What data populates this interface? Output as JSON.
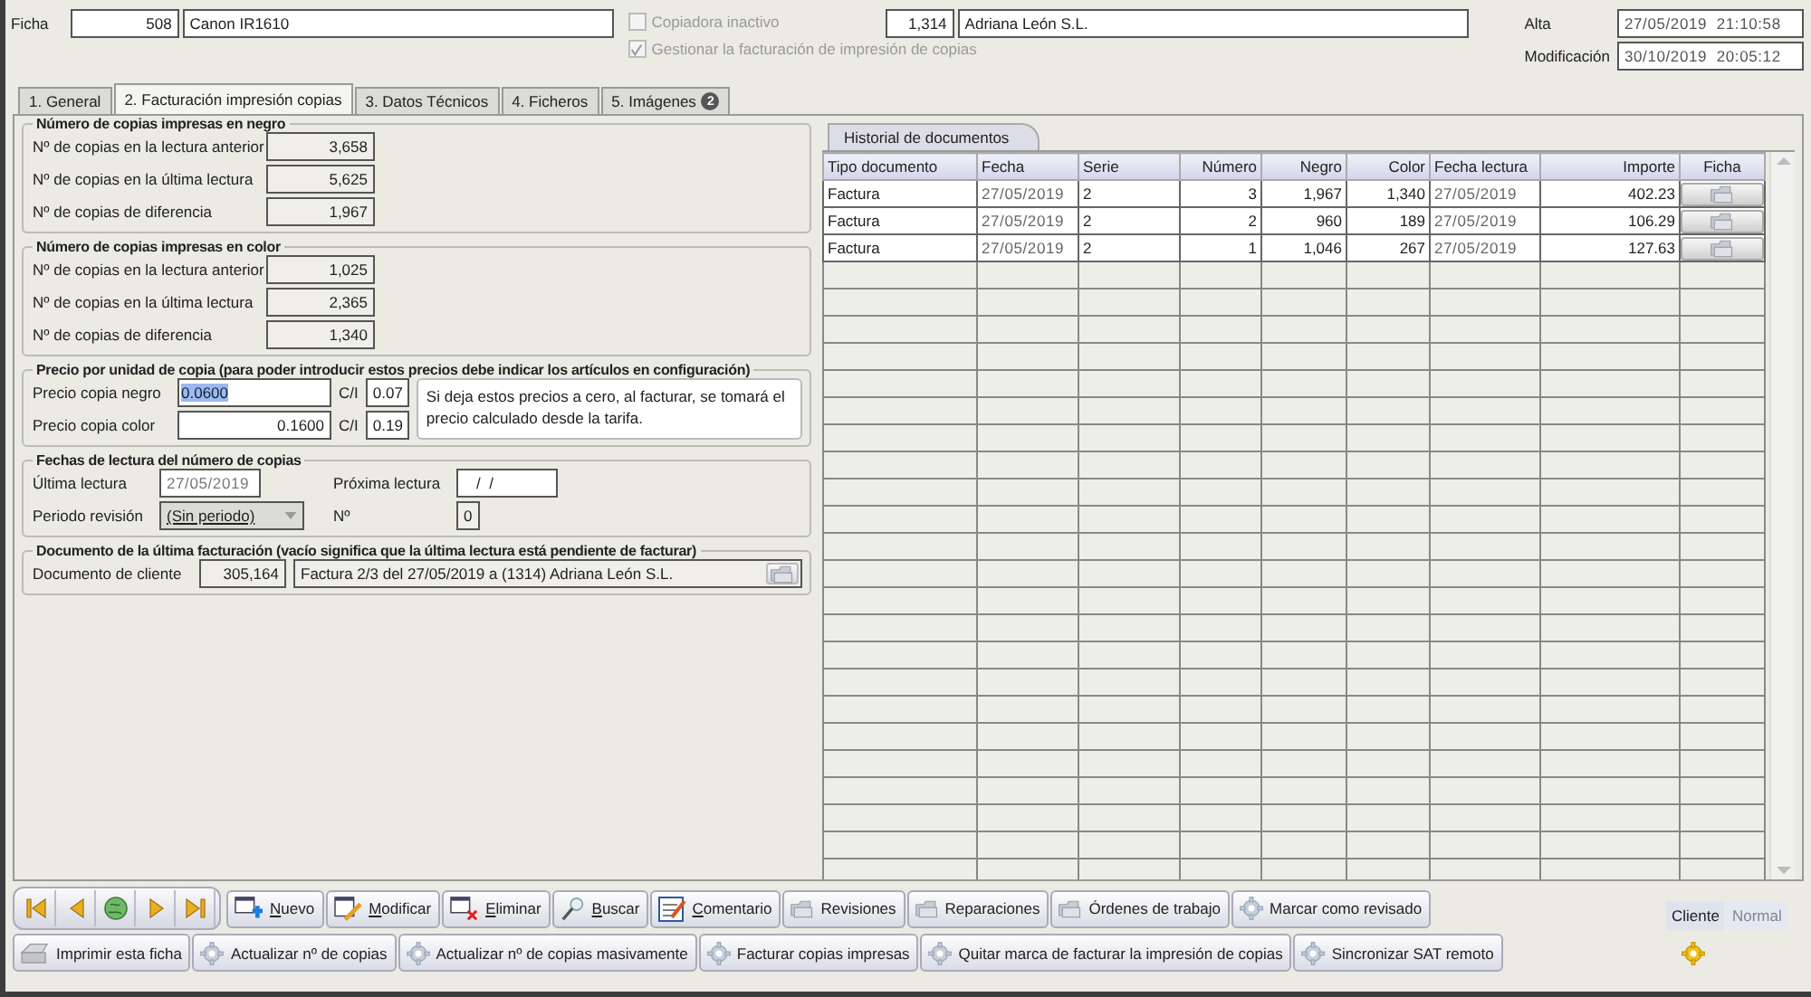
{
  "header": {
    "ficha_label": "Ficha",
    "ficha_number": "508",
    "ficha_name": "Canon IR1610",
    "checkboxes": [
      {
        "label": "Copiadora inactivo",
        "checked": false,
        "disabled": true
      },
      {
        "label": "Gestionar la facturación de impresión de copias",
        "checked": true,
        "disabled": true
      }
    ],
    "client_code": "1,314",
    "client_name": "Adriana León S.L.",
    "dates": [
      {
        "label": "Alta",
        "value": "27/05/2019  21:10:58"
      },
      {
        "label": "Modificación",
        "value": "30/10/2019  20:05:12"
      }
    ]
  },
  "tabs": [
    {
      "label": "1. General",
      "selected": false
    },
    {
      "label": "2. Facturación impresión copias",
      "selected": true
    },
    {
      "label": "3. Datos Técnicos",
      "selected": false
    },
    {
      "label": "4. Ficheros",
      "selected": false
    },
    {
      "label": "5. Imágenes",
      "badge": "2",
      "selected": false
    }
  ],
  "groups": [
    {
      "title": "Número de copias impresas en negro",
      "rows": [
        {
          "label": "Nº de copias en la lectura anterior",
          "value": "3,658",
          "readonly": true
        },
        {
          "label": "Nº de copias en la última lectura",
          "value": "5,625",
          "readonly": true
        },
        {
          "label": "Nº de copias de diferencia",
          "value": "1,967",
          "readonly": true
        }
      ]
    },
    {
      "title": "Número de copias impresas en color",
      "rows": [
        {
          "label": "Nº de copias en la lectura anterior",
          "value": "1,025",
          "readonly": true
        },
        {
          "label": "Nº de copias en la última lectura",
          "value": "2,365",
          "readonly": true
        },
        {
          "label": "Nº de copias de diferencia",
          "value": "1,340",
          "readonly": true
        }
      ]
    }
  ],
  "prices": {
    "title": "Precio por unidad de copia (para poder introducir estos precios debe indicar los artículos en configuración)",
    "rows": [
      {
        "label": "Precio copia negro",
        "value": "0.0600",
        "text_selected": true,
        "ci_label": "C/I",
        "ci_value": "0.07"
      },
      {
        "label": "Precio copia color",
        "value": "0.1600",
        "text_selected": false,
        "ci_label": "C/I",
        "ci_value": "0.19"
      }
    ],
    "note": "Si deja estos precios a cero, al facturar, se tomará el precio calculado desde la tarifa."
  },
  "reading_dates": {
    "title": "Fechas de lectura del número de copias",
    "last_label": "Última lectura",
    "last_value": "27/05/2019",
    "next_label": "Próxima lectura",
    "next_value": "/  /",
    "period_label": "Periodo revisión",
    "period_value": "(Sin periodo)",
    "count_label": "Nº",
    "count_value": "0"
  },
  "last_invoice": {
    "title": "Documento de la última facturación (vacío significa que la última lectura está pendiente de facturar)",
    "label": "Documento de cliente",
    "number": "305,164",
    "description": "Factura 2/3 del 27/05/2019 a (1314) Adriana León S.L."
  },
  "history": {
    "tab": "Historial de documentos",
    "columns": [
      {
        "label": "Tipo documento"
      },
      {
        "label": "Fecha"
      },
      {
        "label": "Serie"
      },
      {
        "label": "Número"
      },
      {
        "label": "Negro"
      },
      {
        "label": "Color"
      },
      {
        "label": "Fecha lectura"
      },
      {
        "label": "Importe"
      },
      {
        "label": "Ficha"
      }
    ],
    "rows": [
      [
        "Factura",
        "27/05/2019",
        "2",
        "3",
        "1,967",
        "1,340",
        "27/05/2019",
        "402.23"
      ],
      [
        "Factura",
        "27/05/2019",
        "2",
        "2",
        "960",
        "189",
        "27/05/2019",
        "106.29"
      ],
      [
        "Factura",
        "27/05/2019",
        "2",
        "1",
        "1,046",
        "267",
        "27/05/2019",
        "127.63"
      ]
    ]
  },
  "toolbar_rows": [
    [
      {
        "label": "Nuevo",
        "kind": "new",
        "mnemonic": true
      },
      {
        "label": "Modificar",
        "kind": "edit",
        "mnemonic": true
      },
      {
        "label": "Eliminar",
        "kind": "delete",
        "mnemonic": true
      },
      {
        "label": "Buscar",
        "kind": "search",
        "mnemonic": true
      },
      {
        "label": "Comentario",
        "kind": "comment",
        "mnemonic": true
      },
      {
        "label": "Revisiones",
        "kind": "record",
        "mnemonic": false
      },
      {
        "label": "Reparaciones",
        "kind": "record",
        "mnemonic": false
      },
      {
        "label": "Órdenes de trabajo",
        "kind": "record",
        "mnemonic": false
      },
      {
        "label": "Marcar como revisado",
        "kind": "process",
        "mnemonic": false
      }
    ],
    [
      {
        "label": "Imprimir esta ficha",
        "kind": "print",
        "mnemonic": false
      },
      {
        "label": "Actualizar nº de copias",
        "kind": "process",
        "mnemonic": false
      },
      {
        "label": "Actualizar nº de copias masivamente",
        "kind": "process",
        "mnemonic": false
      },
      {
        "label": "Facturar copias impresas",
        "kind": "process",
        "mnemonic": false
      },
      {
        "label": "Quitar marca de facturar la impresión de copias",
        "kind": "process",
        "mnemonic": false
      },
      {
        "label": "Sincronizar SAT remoto",
        "kind": "process",
        "mnemonic": false
      }
    ]
  ],
  "view_modes": [
    {
      "label": "Cliente",
      "selected": true
    },
    {
      "label": "Normal",
      "selected": false
    }
  ]
}
